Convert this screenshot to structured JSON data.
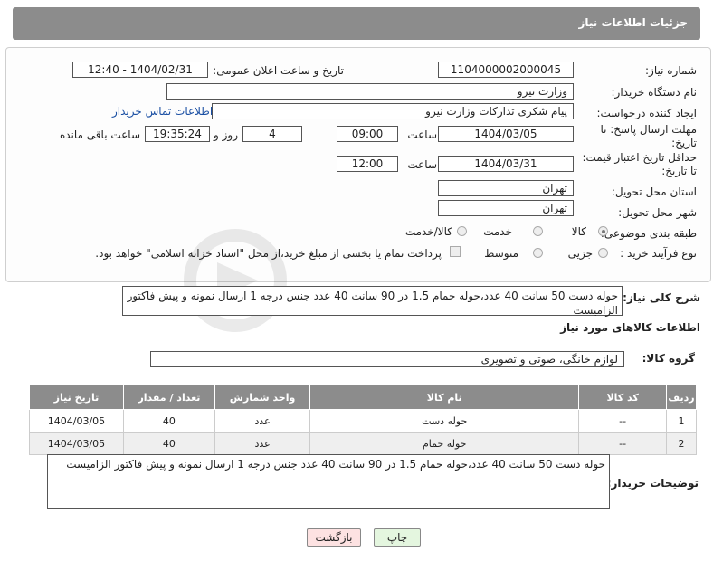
{
  "header": {
    "title": "جزئیات اطلاعات نیاز"
  },
  "form": {
    "need_number_label": "شماره نیاز:",
    "need_number": "1104000002000045",
    "announce_label": "تاریخ و ساعت اعلان عمومی:",
    "announce_value": "1404/02/31 - 12:40",
    "buyer_label": "نام دستگاه خریدار:",
    "buyer_value": "وزارت نیرو",
    "creator_label": "ایجاد کننده درخواست:",
    "creator_value": "پیام شکری تدارکات وزارت نیرو",
    "contact_link": "اطلاعات تماس خریدار",
    "deadline_label_1": "مهلت ارسال پاسخ: تا",
    "deadline_label_2": "تاریخ:",
    "deadline_date": "1404/03/05",
    "time_label": "ساعت",
    "deadline_time": "09:00",
    "days_value": "4",
    "days_label": "روز و",
    "remaining_time": "19:35:24",
    "remaining_label": "ساعت باقی مانده",
    "validity_label_1": "حداقل تاریخ اعتبار قیمت:",
    "validity_label_2": "تا تاریخ:",
    "validity_date": "1404/03/31",
    "validity_time": "12:00",
    "province_label": "استان محل تحویل:",
    "province_value": "تهران",
    "city_label": "شهر محل تحویل:",
    "city_value": "تهران",
    "category_label": "طبقه بندی موضوعی:",
    "category_options": [
      "کالا",
      "خدمت",
      "کالا/خدمت"
    ],
    "category_selected": "کالا",
    "process_label": "نوع فرآیند خرید :",
    "process_options": [
      "جزیی",
      "متوسط"
    ],
    "payment_note": "پرداخت تمام یا بخشی از مبلغ خرید،از محل \"اسناد خزانه اسلامی\" خواهد بود."
  },
  "description": {
    "label": "شرح کلی نیاز:",
    "text": "حوله دست 50 سانت 40 عدد،حوله حمام 1.5 در 90 سانت 40 عدد جنس درجه 1 ارسال نمونه و پیش فاکتور الزامیست"
  },
  "goods": {
    "section_title": "اطلاعات کالاهای مورد نیاز",
    "group_label": "گروه کالا:",
    "group_value": "لوازم خانگی، صوتی و تصویری",
    "columns": [
      "ردیف",
      "کد کالا",
      "نام کالا",
      "واحد شمارش",
      "تعداد / مقدار",
      "تاریخ نیاز"
    ],
    "rows": [
      [
        "1",
        "--",
        "حوله دست",
        "عدد",
        "40",
        "1404/03/05"
      ],
      [
        "2",
        "--",
        "حوله حمام",
        "عدد",
        "40",
        "1404/03/05"
      ]
    ]
  },
  "buyer_notes": {
    "label": "توضیحات خریدار:",
    "text": "حوله دست 50 سانت 40 عدد،حوله حمام 1.5 در 90 سانت 40 عدد جنس درجه 1 ارسال نمونه و پیش فاکتور الزامیست"
  },
  "buttons": {
    "print": "چاپ",
    "back": "بازگشت"
  },
  "colors": {
    "header_bg": "#8c8c8c",
    "link": "#1a4fa3",
    "back_bg": "#fde2e2",
    "print_bg": "#e4f6df"
  }
}
